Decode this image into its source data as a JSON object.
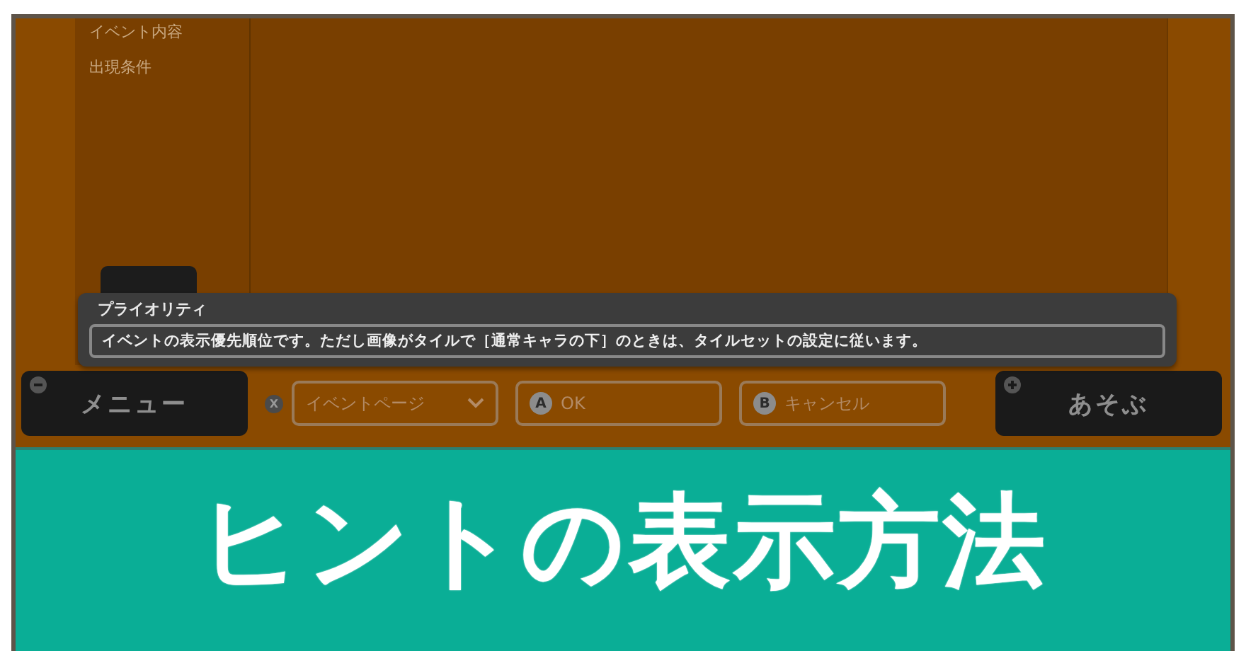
{
  "sidebar": {
    "items": [
      {
        "label": "イベント内容"
      },
      {
        "label": "出現条件"
      }
    ]
  },
  "hint": {
    "title": "プライオリティ",
    "text": "イベントの表示優先順位です。ただし画像がタイルで［通常キャラの下］のときは、タイルセットの設定に従います。"
  },
  "controls": [
    {
      "kind": "menu",
      "label": "メニュー"
    },
    {
      "kind": "dropdown",
      "key": "X",
      "label": "イベントページ"
    },
    {
      "kind": "action",
      "key": "A",
      "label": "OK"
    },
    {
      "kind": "action",
      "key": "B",
      "label": "キャンセル"
    },
    {
      "kind": "play",
      "label": "あそぶ"
    }
  ],
  "banner": {
    "title": "ヒントの表示方法"
  }
}
